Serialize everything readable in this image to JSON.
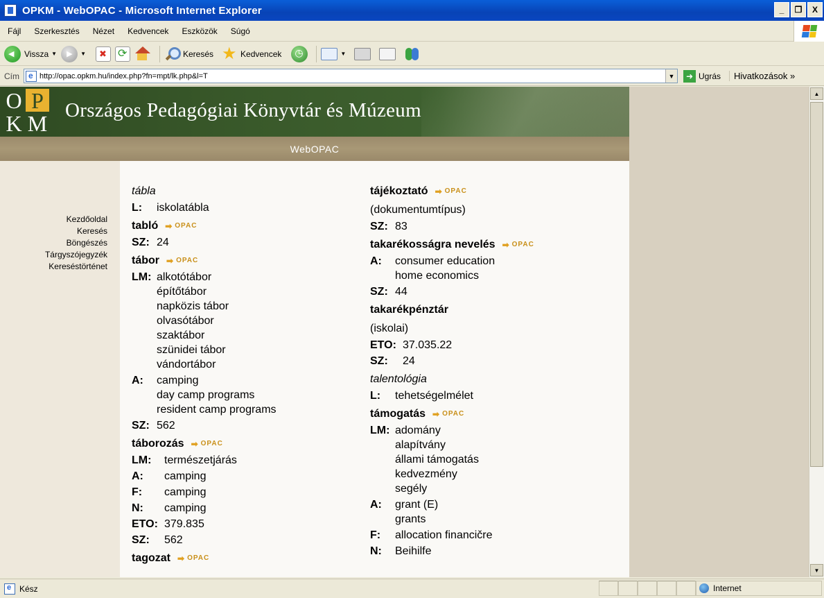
{
  "window": {
    "title": "OPKM - WebOPAC - Microsoft Internet Explorer",
    "btn_min": "_",
    "btn_max": "❐",
    "btn_close": "X"
  },
  "menu": [
    "Fájl",
    "Szerkesztés",
    "Nézet",
    "Kedvencek",
    "Eszközök",
    "Súgó"
  ],
  "toolbar": {
    "back": "Vissza",
    "search": "Keresés",
    "favorites": "Kedvencek"
  },
  "address": {
    "label": "Cím",
    "url": "http://opac.opkm.hu/index.php?fn=mpt/lk.php&l=T",
    "go": "Ugrás",
    "links": "Hivatkozások"
  },
  "site": {
    "logo": [
      "O",
      "P",
      "K",
      "M"
    ],
    "title": "Országos Pedagógiai Könyvtár és Múzeum",
    "subtitle": "WebOPAC",
    "nav": [
      "Kezdőoldal",
      "Keresés",
      "Böngészés",
      "Tárgyszójegyzék",
      "Kereséstörténet"
    ],
    "opac_label": "OPAC"
  },
  "left": {
    "e1": {
      "term": "tábla",
      "l_lab": "L:",
      "l_val": "iskolatábla"
    },
    "e2": {
      "term": "tabló",
      "sz_lab": "SZ:",
      "sz_val": "24"
    },
    "e3": {
      "term": "tábor",
      "lm_lab": "LM:",
      "lm": [
        "alkotótábor",
        "építőtábor",
        "napközis tábor",
        "olvasótábor",
        "szaktábor",
        "szünidei tábor",
        "vándortábor"
      ],
      "a_lab": "A:",
      "a": [
        "camping",
        "day camp programs",
        "resident camp programs"
      ],
      "sz_lab": "SZ:",
      "sz_val": "562"
    },
    "e4": {
      "term": "táborozás",
      "lm_lab": "LM:",
      "lm_val": "természetjárás",
      "a_lab": "A:",
      "a_val": "camping",
      "f_lab": "F:",
      "f_val": "camping",
      "n_lab": "N:",
      "n_val": "camping",
      "eto_lab": "ETO:",
      "eto_val": "379.835",
      "sz_lab": "SZ:",
      "sz_val": "562"
    },
    "e5": {
      "term": "tagozat"
    }
  },
  "right": {
    "e1": {
      "term": "tájékoztató",
      "desc": "(dokumentumtípus)",
      "sz_lab": "SZ:",
      "sz_val": "83"
    },
    "e2": {
      "term": "takarékosságra nevelés",
      "a_lab": "A:",
      "a": [
        "consumer education",
        "home economics"
      ],
      "sz_lab": "SZ:",
      "sz_val": "44"
    },
    "e3": {
      "term": "takarékpénztár",
      "desc": "(iskolai)",
      "eto_lab": "ETO:",
      "eto_val": "37.035.22",
      "sz_lab": "SZ:",
      "sz_val": "24"
    },
    "e4": {
      "term": "talentológia",
      "l_lab": "L:",
      "l_val": "tehetségelmélet"
    },
    "e5": {
      "term": "támogatás",
      "lm_lab": "LM:",
      "lm": [
        "adomány",
        "alapítvány",
        "állami támogatás",
        "kedvezmény",
        "segély"
      ],
      "a_lab": "A:",
      "a": [
        "grant (E)",
        "grants"
      ],
      "f_lab": "F:",
      "f_val": "allocation financičre",
      "n_lab": "N:",
      "n_val": "Beihilfe"
    }
  },
  "status": {
    "text": "Kész",
    "zone": "Internet"
  }
}
